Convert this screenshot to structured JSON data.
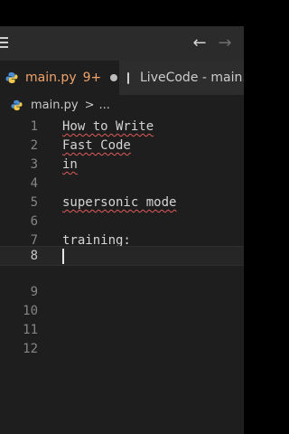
{
  "topbar": {
    "menu_icon": "hamburger-menu-icon",
    "back_glyph": "←",
    "forward_glyph": "→"
  },
  "tabs": [
    {
      "label": "main.py",
      "modified": "9+",
      "state": "active",
      "icon": "python-icon"
    },
    {
      "label": "LiveCode - main.",
      "state": "inactive",
      "icon": "document-icon"
    }
  ],
  "breadcrumb": {
    "file": "main.py",
    "separator": ">",
    "more": "..."
  },
  "editor": {
    "lines": [
      {
        "number": "1",
        "text": "How to Write"
      },
      {
        "number": "2",
        "text": "Fast Code"
      },
      {
        "number": "3",
        "text": "in"
      },
      {
        "number": "4",
        "text": ""
      },
      {
        "number": "5",
        "text": "supersonic mode"
      },
      {
        "number": "6",
        "text": ""
      },
      {
        "number": "7",
        "text": "training:"
      },
      {
        "number": "8",
        "text": ""
      },
      {
        "number": "9",
        "text": ""
      },
      {
        "number": "10",
        "text": ""
      },
      {
        "number": "11",
        "text": ""
      },
      {
        "number": "12",
        "text": ""
      }
    ],
    "active_line": "8"
  },
  "colors": {
    "modified_accent": "#f0a36b",
    "editor_bg": "#1e1e1e",
    "error_squiggle": "#e05a5a"
  }
}
